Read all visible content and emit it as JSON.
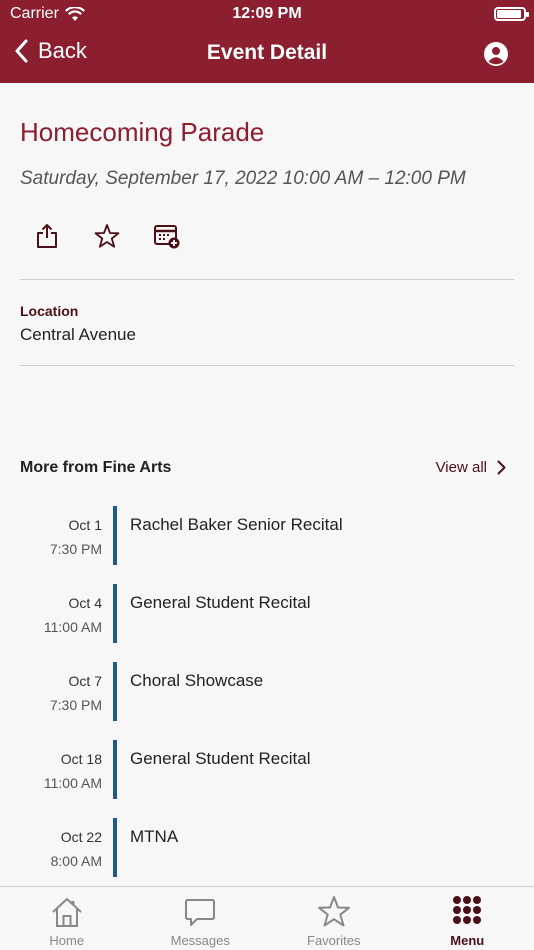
{
  "status_bar": {
    "carrier": "Carrier",
    "time": "12:09 PM"
  },
  "nav": {
    "back_label": "Back",
    "title": "Event Detail"
  },
  "event": {
    "title": "Homecoming Parade",
    "datetime": "Saturday, September 17, 2022 10:00 AM – 12:00 PM",
    "location_label": "Location",
    "location_value": "Central Avenue"
  },
  "more": {
    "title": "More from Fine Arts",
    "view_all": "View all",
    "items": [
      {
        "date": "Oct 1",
        "time": "7:30 PM",
        "name": "Rachel Baker Senior Recital"
      },
      {
        "date": "Oct 4",
        "time": "11:00 AM",
        "name": "General Student Recital"
      },
      {
        "date": "Oct 7",
        "time": "7:30 PM",
        "name": "Choral Showcase"
      },
      {
        "date": "Oct 18",
        "time": "11:00 AM",
        "name": "General Student Recital"
      },
      {
        "date": "Oct 22",
        "time": "8:00 AM",
        "name": "MTNA"
      }
    ]
  },
  "tabs": [
    {
      "label": "Home",
      "icon": "home-icon"
    },
    {
      "label": "Messages",
      "icon": "chat-bubble-icon"
    },
    {
      "label": "Favorites",
      "icon": "star-icon"
    },
    {
      "label": "Menu",
      "icon": "dots-grid-icon",
      "active": true
    }
  ],
  "colors": {
    "brand": "#8b1e2f",
    "accent_bar": "#1f5a8a",
    "label_dark": "#4a1018"
  }
}
